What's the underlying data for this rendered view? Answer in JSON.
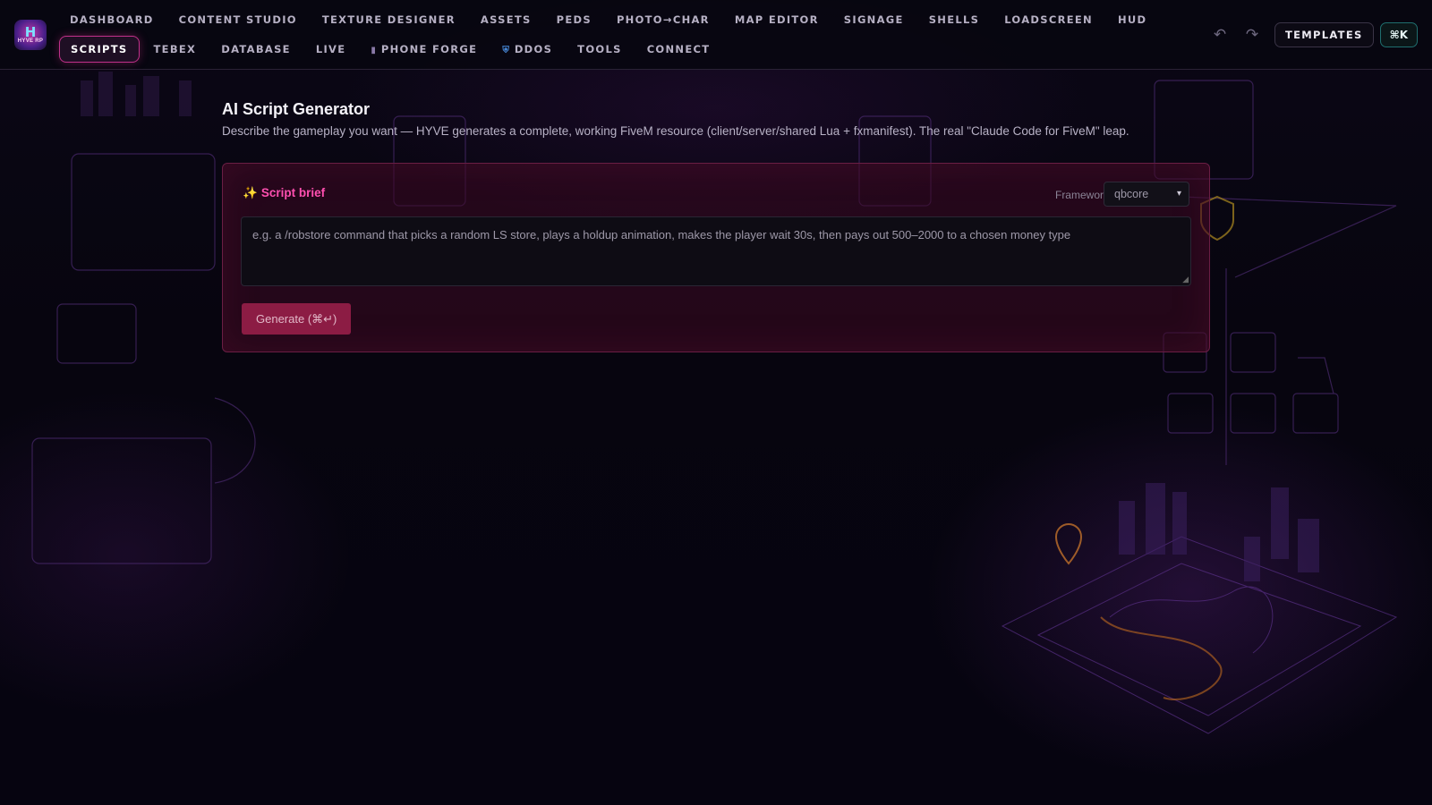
{
  "app": {
    "logo_main": "H",
    "logo_sub": "HYVE RP"
  },
  "nav": {
    "row1": [
      "DASHBOARD",
      "CONTENT STUDIO",
      "TEXTURE DESIGNER",
      "ASSETS",
      "PEDS",
      "PHOTO→CHAR",
      "MAP EDITOR",
      "SIGNAGE",
      "SHELLS",
      "LOADSCREEN",
      "HUD"
    ],
    "row2": [
      {
        "label": "SCRIPTS",
        "active": true
      },
      {
        "label": "TEBEX"
      },
      {
        "label": "DATABASE"
      },
      {
        "label": "LIVE"
      },
      {
        "label": "PHONE FORGE",
        "icon": "phone-icon"
      },
      {
        "label": "DDOS",
        "icon": "shield-icon"
      },
      {
        "label": "TOOLS"
      },
      {
        "label": "CONNECT"
      }
    ],
    "templates_label": "TEMPLATES",
    "cmdk_label": "⌘K"
  },
  "main": {
    "title": "AI Script Generator",
    "subtitle": "Describe the gameplay you want — HYVE generates a complete, working FiveM resource (client/server/shared Lua + fxmanifest). The real \"Claude Code for FiveM\" leap.",
    "card": {
      "title": "Script brief",
      "framework_label": "Framework",
      "framework_value": "qbcore",
      "brief_placeholder": "e.g. a /robstore command that picks a random LS store, plays a holdup animation, makes the player wait 30s, then pays out 500–2000 to a chosen money type",
      "generate_label": "Generate (⌘↵)"
    }
  },
  "colors": {
    "accent": "#ff4fb0",
    "active_border": "#c0308a",
    "card_border": "#6a1e44",
    "button": "#8c1c44"
  }
}
